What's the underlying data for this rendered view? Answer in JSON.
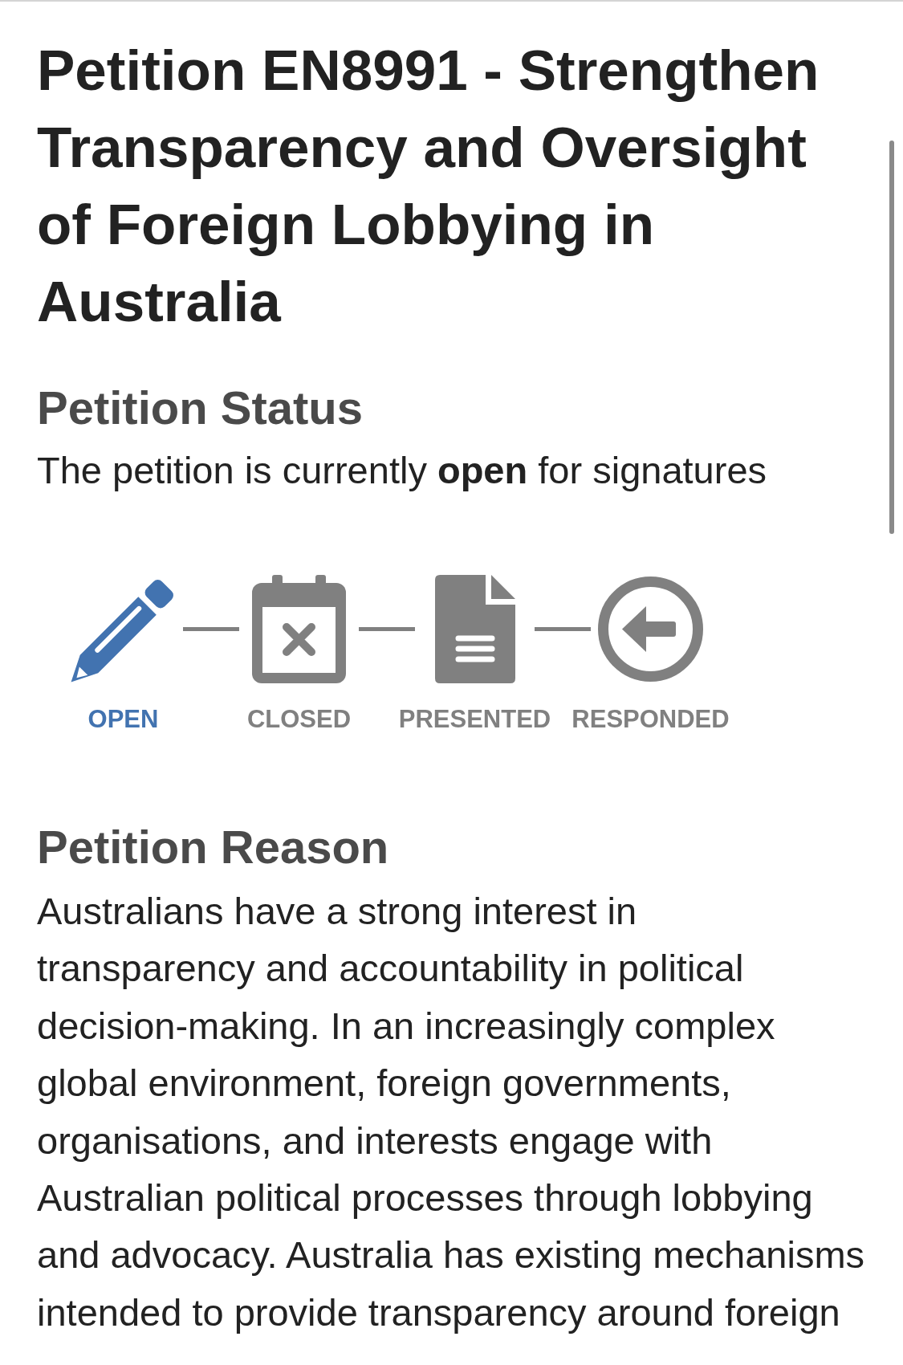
{
  "title": "Petition EN8991 - Strengthen Transparency and Oversight of Foreign Lobbying in Australia",
  "status": {
    "heading": "Petition Status",
    "text": "The petition is currently **open** for signatures",
    "steps": [
      {
        "label": "OPEN",
        "current": true
      },
      {
        "label": "CLOSED",
        "current": false
      },
      {
        "label": "PRESENTED",
        "current": false
      },
      {
        "label": "RESPONDED",
        "current": false
      }
    ]
  },
  "reason": {
    "heading": "Petition Reason",
    "text": "Australians have a strong interest in\ntransparency and accountability in political\ndecision-making. In an increasingly complex\nglobal environment, foreign governments,\norganisations, and interests engage with\nAustralian political processes through lobbying\nand advocacy. Australia has existing mechanisms\nintended to provide transparency around foreign"
  }
}
